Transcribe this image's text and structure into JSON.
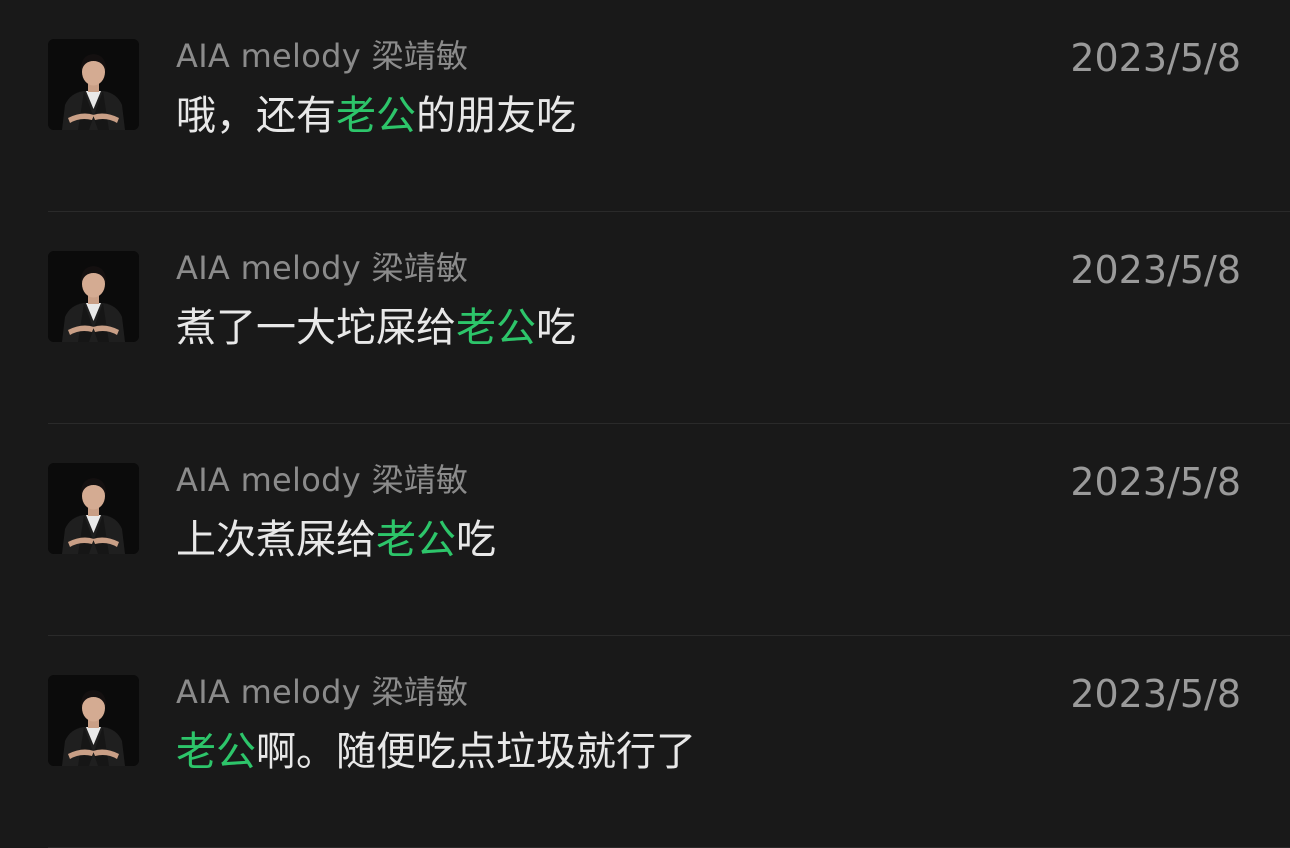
{
  "colors": {
    "background": "#191919",
    "highlight": "#2dc56a",
    "sender_text": "#8b8b8b",
    "message_text": "#e8e8e8",
    "date_text": "#9a9a9a"
  },
  "results": [
    {
      "sender": "AIA melody 梁靖敏",
      "date": "2023/5/8",
      "message": {
        "before": "哦，还有",
        "highlight": "老公",
        "after": "的朋友吃"
      },
      "avatar_icon": "profile-photo-avatar"
    },
    {
      "sender": "AIA melody 梁靖敏",
      "date": "2023/5/8",
      "message": {
        "before": "煮了一大坨屎给",
        "highlight": "老公",
        "after": "吃"
      },
      "avatar_icon": "profile-photo-avatar"
    },
    {
      "sender": "AIA melody 梁靖敏",
      "date": "2023/5/8",
      "message": {
        "before": "上次煮屎给",
        "highlight": "老公",
        "after": "吃"
      },
      "avatar_icon": "profile-photo-avatar"
    },
    {
      "sender": "AIA melody 梁靖敏",
      "date": "2023/5/8",
      "message": {
        "before": "",
        "highlight": "老公",
        "after": "啊。随便吃点垃圾就行了"
      },
      "avatar_icon": "profile-photo-avatar"
    }
  ]
}
